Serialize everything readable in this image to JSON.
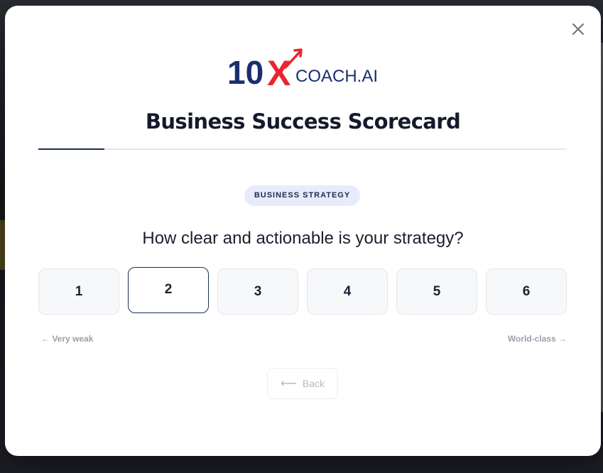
{
  "logo": {
    "number": "10",
    "x": "X",
    "name": "COACH.AI",
    "colors": {
      "navy": "#1a2e6e",
      "red": "#e8262e"
    }
  },
  "close": {
    "icon": "close-icon"
  },
  "title": "Business Success Scorecard",
  "progress": {
    "fraction": 0.125
  },
  "category": "BUSINESS STRATEGY",
  "question": "How clear and actionable is your strategy?",
  "scale": {
    "options": [
      "1",
      "2",
      "3",
      "4",
      "5",
      "6"
    ],
    "selected": "2",
    "low_label": "← Very weak",
    "high_label": "World-class →"
  },
  "back": {
    "arrow": "⟵",
    "label": "Back"
  },
  "colors": {
    "accent": "#1e2f54",
    "pill_bg": "#e6ecfb"
  }
}
